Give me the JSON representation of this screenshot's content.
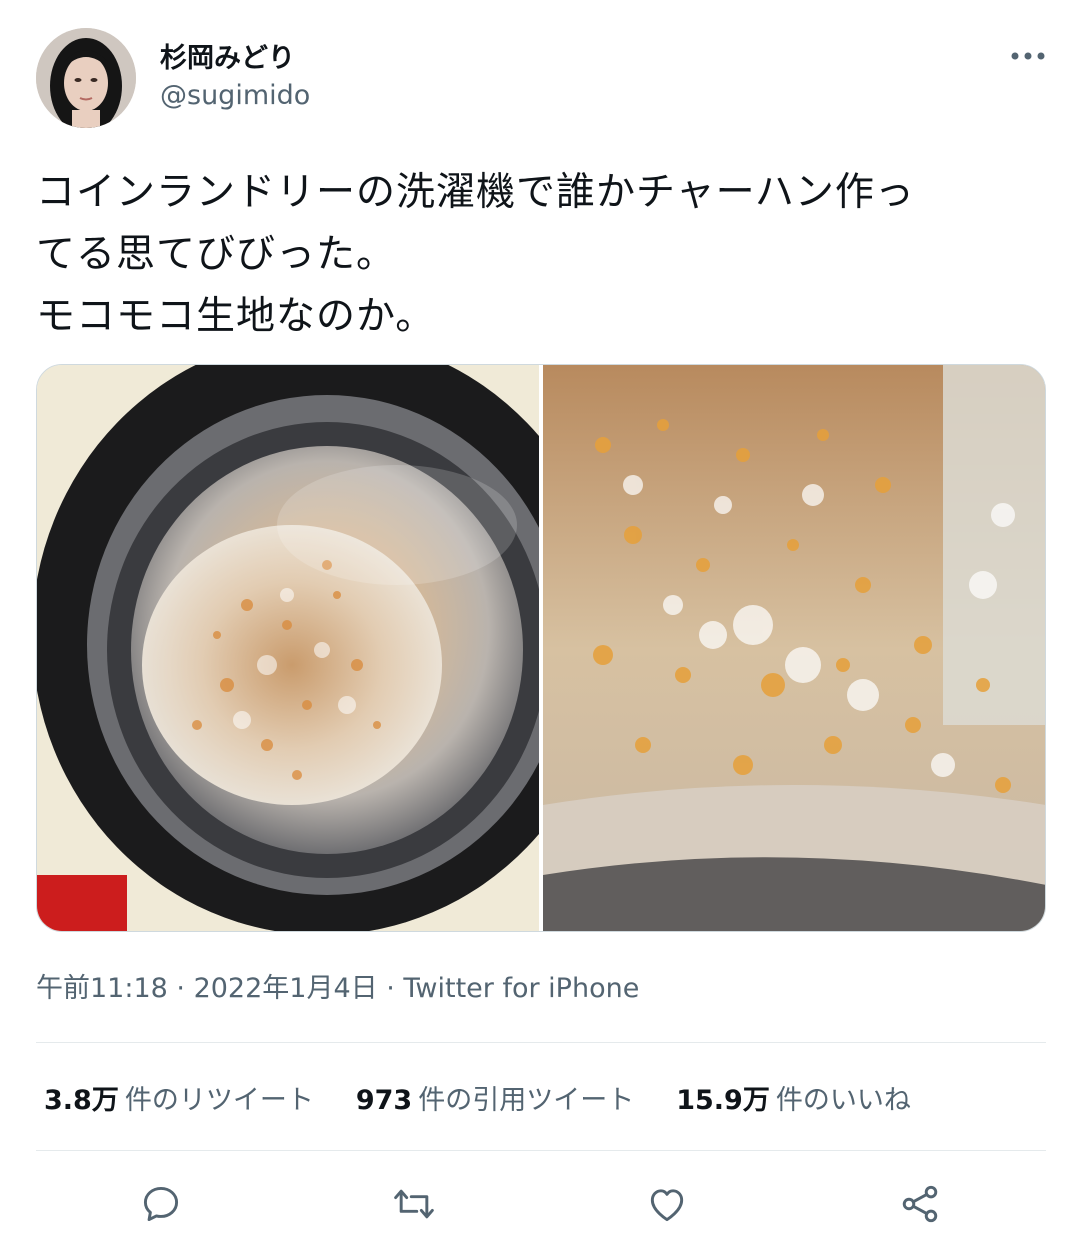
{
  "author": {
    "display_name": "杉岡みどり",
    "handle": "@sugimido"
  },
  "tweet": {
    "text": "コインランドリーの洗濯機で誰かチャーハン作っ\nてる思てびびった。\nモコモコ生地なのか。"
  },
  "meta": {
    "time": "午前11:18",
    "separator": " · ",
    "date": "2022年1月4日",
    "source": "Twitter for iPhone"
  },
  "stats": [
    {
      "count": "3.8万",
      "label": "件のリツイート"
    },
    {
      "count": "973",
      "label": "件の引用ツイート"
    },
    {
      "count": "15.9万",
      "label": "件のいいね"
    }
  ],
  "icons": {
    "more": "more-horizontal-icon",
    "reply": "reply-bubble-icon",
    "retweet": "retweet-icon",
    "like": "heart-icon",
    "share": "share-icon"
  },
  "colors": {
    "text": "#0f1419",
    "secondary": "#536471",
    "divider": "#e5eaec"
  }
}
